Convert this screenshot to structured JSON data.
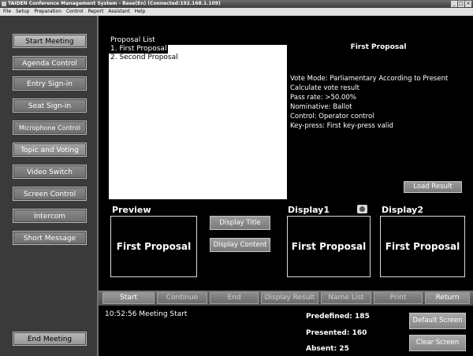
{
  "window": {
    "title": "TAIDEN Conference Management System - Base(En) (Connected:192.168.1.109)",
    "controls": [
      "_",
      "□",
      "×"
    ]
  },
  "menu": [
    "File",
    "Setup",
    "Preparation",
    "Control",
    "Report",
    "Assistant",
    "Help"
  ],
  "sidebar": {
    "items": [
      {
        "label": "Start Meeting"
      },
      {
        "label": "Agenda Control"
      },
      {
        "label": "Entry Sign-in"
      },
      {
        "label": "Seat Sign-in"
      },
      {
        "label": "Microphone Control"
      },
      {
        "label": "Topic and Voting"
      },
      {
        "label": "Video Switch"
      },
      {
        "label": "Screen Control"
      },
      {
        "label": "Intercom"
      },
      {
        "label": "Short Message"
      }
    ],
    "end_meeting": "End Meeting"
  },
  "proposal_list": {
    "label": "Proposal List",
    "items": [
      "1. First Proposal",
      "2. Second Proposal"
    ],
    "selected_index": 0
  },
  "details": {
    "title": "First Proposal",
    "lines": [
      "Vote Mode: Parliamentary According to Present",
      "Calculate vote result",
      "Pass rate: >50.00%",
      "Nominative: Ballot",
      "Control: Operator control",
      "Key-press: First key-press valid"
    ],
    "load_result": "Load Result"
  },
  "preview": {
    "label": "Preview",
    "content": "First Proposal",
    "display_title": "Display Title",
    "display_content": "Display Content"
  },
  "display1": {
    "label": "Display1",
    "content": "First Proposal"
  },
  "display2": {
    "label": "Display2",
    "content": "First Proposal"
  },
  "bottom_buttons": [
    "Start",
    "Continue",
    "End",
    "Display Result",
    "Name List",
    "Print",
    "Return"
  ],
  "status": {
    "log": "10:52:56 Meeting Start",
    "predefined": "Predefined: 185",
    "presented": "Presented: 160",
    "absent": "Absent: 25",
    "default_screen": "Default Screen",
    "clear_screen": "Clear Screen"
  }
}
